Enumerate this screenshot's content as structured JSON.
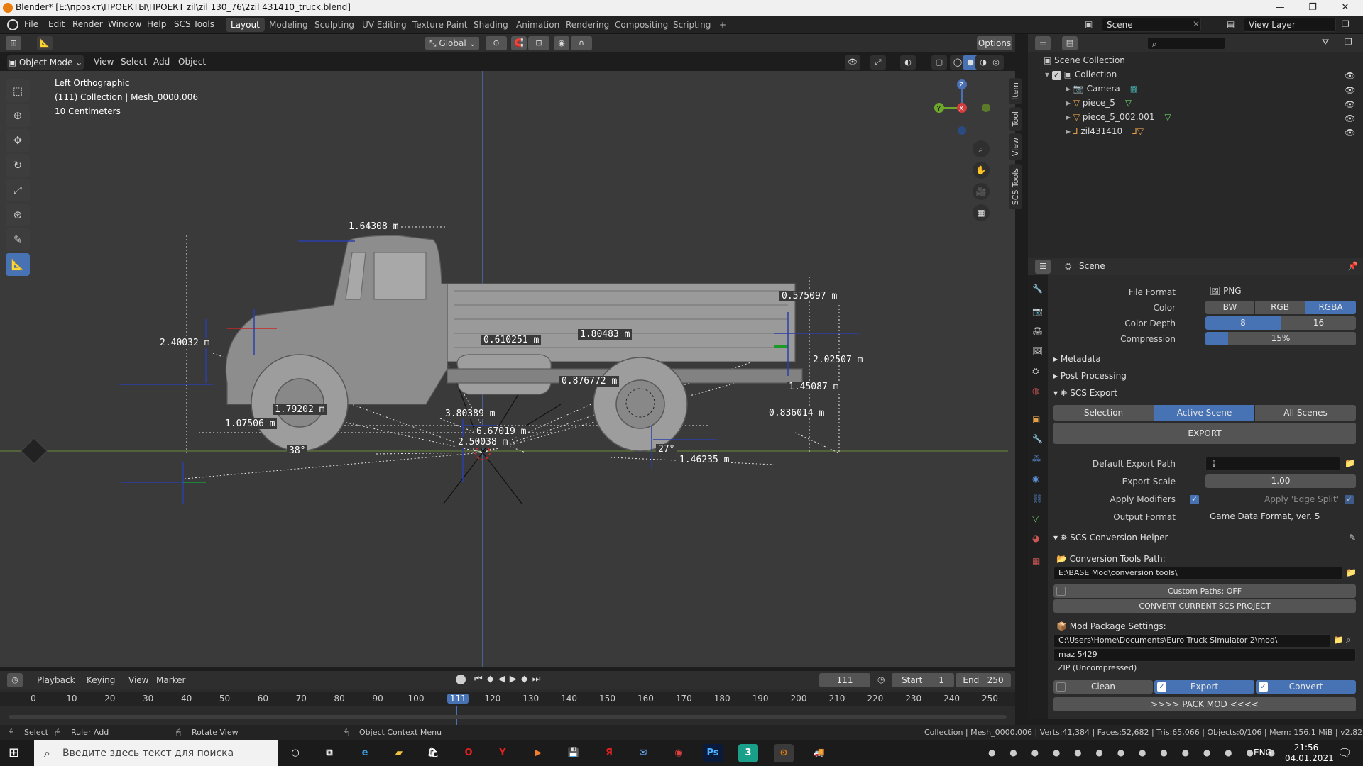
{
  "titlebar": {
    "title": "Blender* [E:\\прозкт\\ПРОЕКТЫ\\ПРОЕКТ zil\\zil 130_76\\2zil 431410_truck.blend]",
    "minimize": "—",
    "maximize": "❐",
    "close": "✕"
  },
  "menu": [
    "File",
    "Edit",
    "Render",
    "Window",
    "Help",
    "SCS Tools"
  ],
  "workspaces": [
    "Layout",
    "Modeling",
    "Sculpting",
    "UV Editing",
    "Texture Paint",
    "Shading",
    "Animation",
    "Rendering",
    "Compositing",
    "Scripting"
  ],
  "workspace_add": "+",
  "scene_field": "Scene",
  "view_layer_field": "View Layer",
  "viewport_header": {
    "mode": "Object Mode",
    "menus": [
      "View",
      "Select",
      "Add",
      "Object"
    ],
    "transform_orientation": "Global",
    "options": "Options"
  },
  "viewport_overlay": {
    "view_name": "Left Orthographic",
    "collection_info": "(111) Collection | Mesh_0000.006",
    "scale_info": "10 Centimeters"
  },
  "measurements": [
    "1.64308 m",
    "0.575097 m",
    "2.40032 m",
    "0.610251 m",
    "1.80483 m",
    "2.02507 m",
    "0.876772 m",
    "1.45087 m",
    "1.79202 m",
    "3.80389 m",
    "0.836014 m",
    "1.07506 m",
    "6.67019 m",
    "2.50038 m",
    "38°",
    "27°",
    "1.46235 m"
  ],
  "gizmo": {
    "z": "Z",
    "y": "Y",
    "x": "X"
  },
  "side_tabs": [
    "Item",
    "Tool",
    "View",
    "SCS Tools"
  ],
  "outliner": {
    "root": "Scene Collection",
    "collection": "Collection",
    "items": [
      "Camera",
      "piece_5",
      "piece_5_002.001",
      "zil431410"
    ]
  },
  "properties": {
    "header": "Scene",
    "file_format_label": "File Format",
    "file_format": "PNG",
    "color_label": "Color",
    "color_options": [
      "BW",
      "RGB",
      "RGBA"
    ],
    "color_depth_label": "Color Depth",
    "color_depth_options": [
      "8",
      "16"
    ],
    "compression_label": "Compression",
    "compression": "15%",
    "compression_value": 0.15,
    "metadata": "Metadata",
    "post_processing": "Post Processing",
    "scs_export": "SCS Export",
    "export_scope": [
      "Selection",
      "Active Scene",
      "All Scenes"
    ],
    "export_button": "EXPORT",
    "default_export_path_label": "Default Export Path",
    "default_export_path": "",
    "export_scale_label": "Export Scale",
    "export_scale": "1.00",
    "apply_modifiers_label": "Apply Modifiers",
    "apply_edge_split_label": "Apply 'Edge Split'",
    "output_format_label": "Output Format",
    "output_format": "Game Data Format, ver. 5",
    "conversion_helper": "SCS Conversion Helper",
    "conversion_tools_path_label": "Conversion Tools Path:",
    "conversion_tools_path": "E:\\BASE Mod\\conversion tools\\",
    "custom_paths": "Custom Paths: OFF",
    "convert_project": "CONVERT CURRENT SCS PROJECT",
    "mod_package_label": "Mod Package Settings:",
    "mod_path": "C:\\Users\\Home\\Documents\\Euro Truck Simulator 2\\mod\\",
    "mod_name": "maz 5429",
    "zip_mode": "ZIP (Uncompressed)",
    "clean": "Clean",
    "export2": "Export",
    "convert": "Convert",
    "pack_mod": ">>>>   PACK MOD   <<<<"
  },
  "timeline": {
    "menus": [
      "Playback",
      "Keying",
      "View",
      "Marker"
    ],
    "current_frame": "111",
    "start_label": "Start",
    "start": "1",
    "end_label": "End",
    "end": "250",
    "ticks": [
      "0",
      "10",
      "20",
      "30",
      "40",
      "50",
      "60",
      "70",
      "80",
      "90",
      "100",
      "111",
      "120",
      "130",
      "140",
      "150",
      "160",
      "170",
      "180",
      "190",
      "200",
      "210",
      "220",
      "230",
      "240",
      "250"
    ]
  },
  "statusbar": {
    "select": "Select",
    "ruler_add": "Ruler Add",
    "rotate_view": "Rotate View",
    "object_context_menu": "Object Context Menu",
    "stats": "Collection | Mesh_0000.006 | Verts:41,384 | Faces:52,682 | Tris:65,066 | Objects:0/106 | Mem: 156.1 MiB | v2.82.7"
  },
  "taskbar": {
    "search_placeholder": "Введите здесь текст для поиска",
    "lang": "ENG",
    "time": "21:56",
    "date": "04.01.2021"
  },
  "colors": {
    "accent": "#4772b3",
    "blender_orange": "#e87d0d",
    "viewport_bg": "#3a3a3a"
  }
}
